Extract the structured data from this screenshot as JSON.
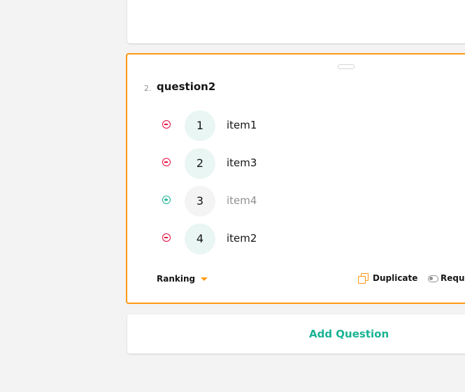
{
  "question": {
    "number": "2.",
    "title": "question2",
    "items": [
      {
        "rank": "1",
        "label": "item1",
        "ranked": true
      },
      {
        "rank": "2",
        "label": "item3",
        "ranked": true
      },
      {
        "rank": "3",
        "label": "item4",
        "ranked": false
      },
      {
        "rank": "4",
        "label": "item2",
        "ranked": true
      }
    ],
    "type_label": "Ranking",
    "duplicate_label": "Duplicate",
    "required_label": "Required"
  },
  "add_question_label": "Add Question",
  "colors": {
    "accent": "#ff9814",
    "remove": "#e50a3e",
    "add": "#19b394",
    "ranked_bg": "#e9f6f3",
    "unranked_bg": "#f4f4f4"
  }
}
